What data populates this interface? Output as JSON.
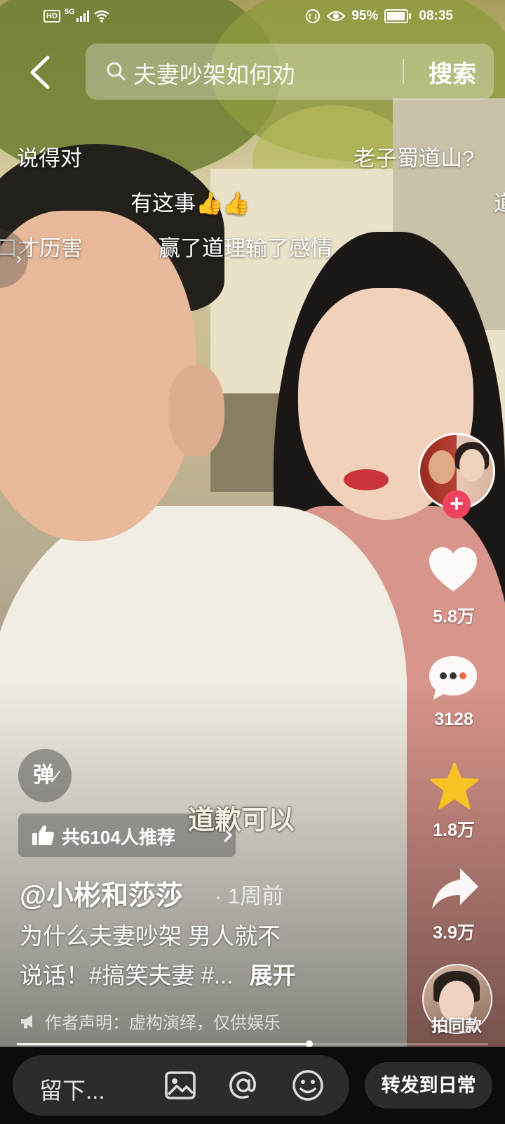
{
  "status_bar": {
    "hd": "HD",
    "network": "5G",
    "battery": "95%",
    "time": "08:35"
  },
  "search": {
    "query": "夫妻吵架如何劝",
    "button": "搜索"
  },
  "danmaku": [
    "说得对",
    "老子蜀道山?",
    "有这事👍👍",
    "口才历害",
    "赢了道理输了感情",
    "道"
  ],
  "video_caption": "道歉可以",
  "rail": {
    "likes": "5.8万",
    "comments": "3128",
    "favorites": "1.8万",
    "shares": "3.9万",
    "same_style": "拍同款"
  },
  "danmu_toggle": "弹",
  "recommend": "共6104人推荐",
  "author": {
    "name": "@小彬和莎莎",
    "time": "· 1周前"
  },
  "description": {
    "line1": "为什么夫妻吵架 男人就不",
    "line2": "说话！#搞笑夫妻 #...",
    "expand": "展开"
  },
  "declaration": "作者声明：虚构演绎，仅供娱乐",
  "progress": 0.62,
  "bottom_bar": {
    "comment_placeholder": "留下...",
    "repost": "转发到日常"
  },
  "colors": {
    "follow": "#f0415f",
    "favorite_star": "#f7c325",
    "bottom_bg": "#0c0c0c"
  }
}
